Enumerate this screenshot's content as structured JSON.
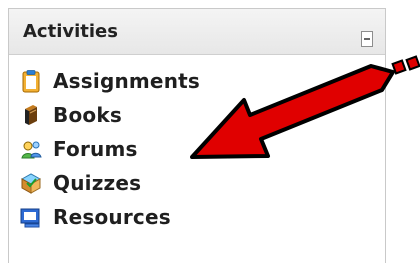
{
  "block": {
    "title": "Activities",
    "items": [
      {
        "label": "Assignments",
        "icon": "assignment-icon"
      },
      {
        "label": "Books",
        "icon": "book-icon"
      },
      {
        "label": "Forums",
        "icon": "forums-icon"
      },
      {
        "label": "Quizzes",
        "icon": "quiz-icon"
      },
      {
        "label": "Resources",
        "icon": "resource-icon"
      }
    ]
  },
  "colors": {
    "arrow_red": "#e00000",
    "arrow_outline": "#000000"
  }
}
